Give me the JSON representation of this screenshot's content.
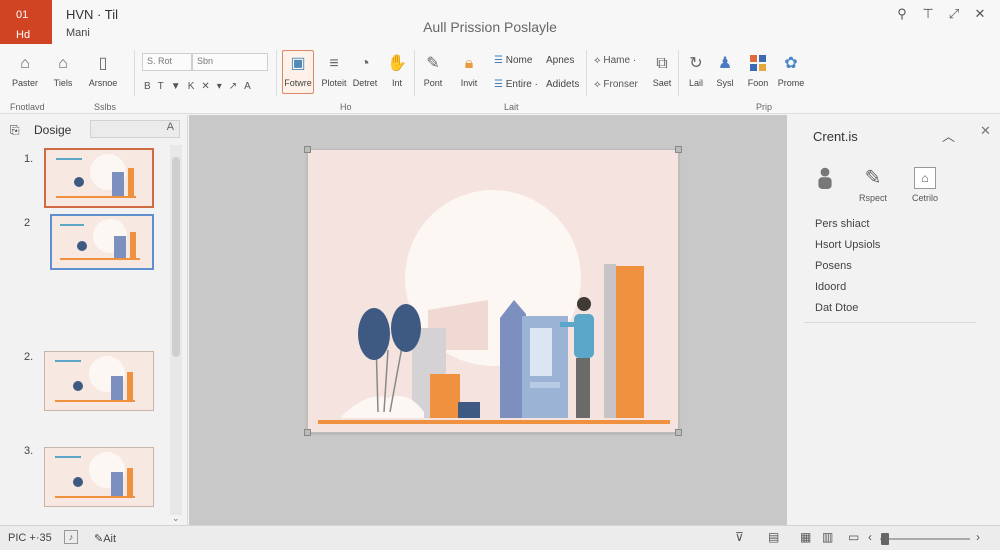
{
  "titlebar": {
    "badge_line1": "01",
    "badge_line2": "Hd",
    "quick_access_title": "HVN · Til",
    "quick_access_sub": "Mani",
    "doc_title": "Aull Prission Poslayle",
    "controls": [
      "pin-icon",
      "pin-alt-icon",
      "resize-icon",
      "close-icon"
    ]
  },
  "ribbon": {
    "paste": "Paster",
    "tiles": "Tiels",
    "arrange": "Arsnoe",
    "font_box_1": "S. Rot",
    "font_box_2": "Sbn",
    "format_buttons": [
      "B",
      "T",
      "▼",
      "K",
      "✕",
      "▾",
      "↗",
      "A"
    ],
    "insert_buttons": [
      "Fotwre",
      "Ploteit",
      "Detret",
      "Int"
    ],
    "pont": "Pont",
    "invit": "Invit",
    "nome": "Nome",
    "apnes": "Apnes",
    "entire": "Entire ·",
    "adidets": "Adidets",
    "home": "Hame ·",
    "fronser": "Fronser",
    "saet": "Saet",
    "lail": "Lail",
    "sysl": "Sysl",
    "foon": "Foon",
    "prome": "Prome",
    "groups": {
      "clipboard": "Fnotlavd",
      "slides": "Sslbs",
      "middle": "Ho",
      "edit": "Lait",
      "right": "Prip"
    }
  },
  "leftpane": {
    "title": "Dosige",
    "search_icon": "A",
    "slides": [
      {
        "num": "1.",
        "state": "active"
      },
      {
        "num": "2",
        "state": "hover"
      },
      {
        "num": "2.",
        "state": "normal"
      },
      {
        "num": "3.",
        "state": "normal"
      }
    ]
  },
  "rightpane": {
    "title": "Crent.is",
    "buttons": [
      "",
      "Rspect",
      "Cetrilo"
    ],
    "items": [
      "Pers shiact",
      "Hsort Upsiols",
      "Posens",
      "Idoord",
      "Dat Dtoe"
    ]
  },
  "statusbar": {
    "left_text": "PIC +·35",
    "edit_text": "Ait",
    "zoom_level": 0.05
  },
  "colors": {
    "accent_red": "#d04423",
    "orange": "#f0913f",
    "slate_blue": "#7c8fbf",
    "navy": "#3f5a82",
    "teal": "#5aa7c9",
    "slide_bg": "#f5e3df"
  }
}
